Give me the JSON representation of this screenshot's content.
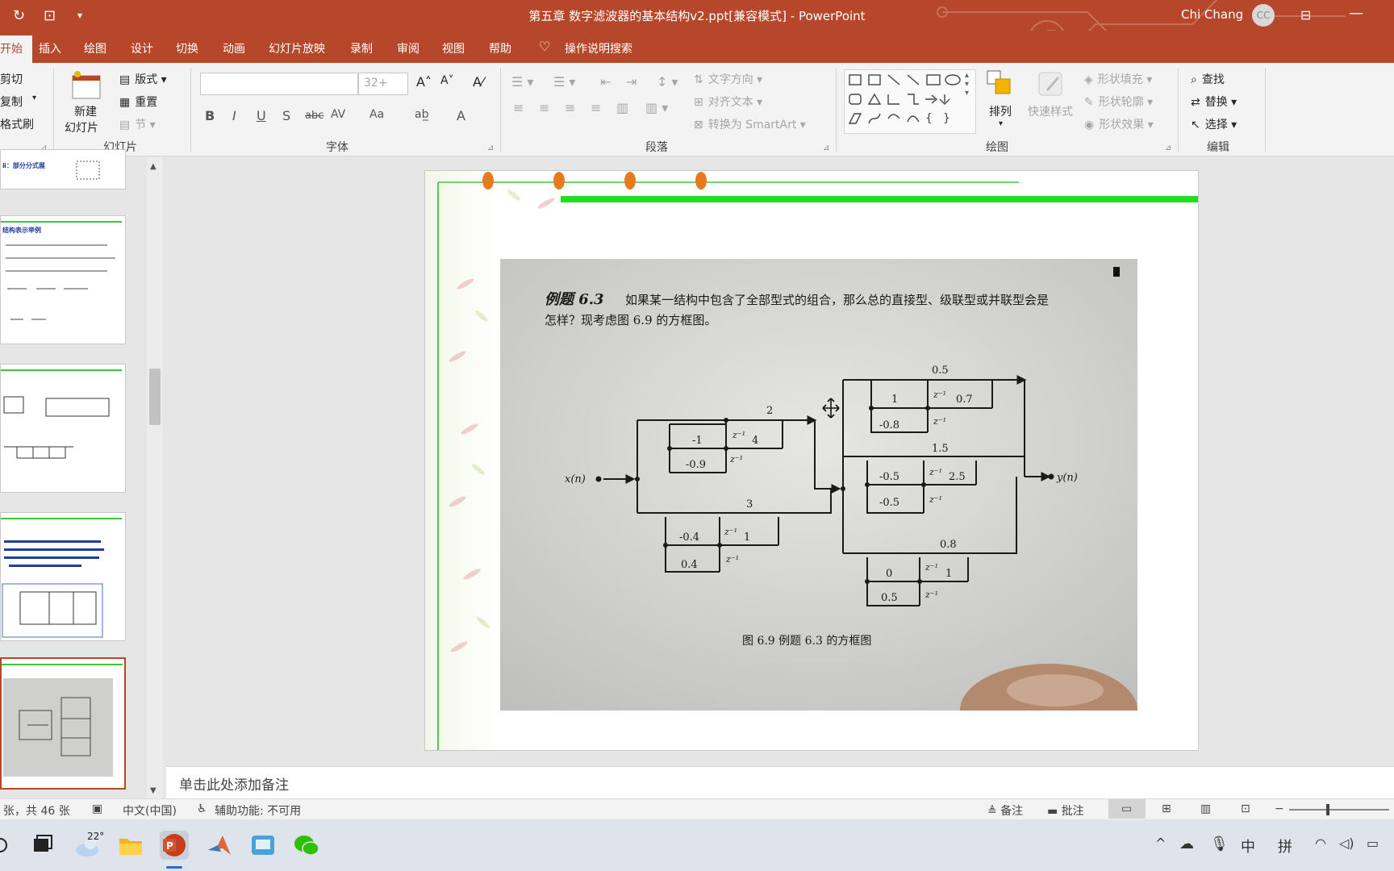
{
  "window": {
    "title": "第五章 数字滤波器的基本结构v2.ppt[兼容模式] - PowerPoint",
    "user": "Chi Chang",
    "avatar_initials": "CC"
  },
  "quick_access": {
    "refresh_icon": "refresh-icon",
    "present_icon": "present-from-start-icon",
    "more_icon": "customize-qat-icon"
  },
  "tabs": [
    "开始",
    "插入",
    "绘图",
    "设计",
    "切换",
    "动画",
    "幻灯片放映",
    "录制",
    "审阅",
    "视图",
    "帮助",
    "操作说明搜索"
  ],
  "ribbon": {
    "clipboard": {
      "cut": "剪切",
      "copy": "复制",
      "format_painter": "格式刷"
    },
    "slides": {
      "new_slide": "新建",
      "new_slide_2": "幻灯片",
      "layout": "版式",
      "reset": "重置",
      "section": "节",
      "label": "幻灯片"
    },
    "font": {
      "size": "32+",
      "label": "字体",
      "buttons": [
        "B",
        "I",
        "U",
        "S",
        "abc",
        "AV",
        "Aa",
        "A"
      ]
    },
    "paragraph": {
      "text_direction": "文字方向",
      "align_text": "对齐文本",
      "smartart": "转换为 SmartArt",
      "label": "段落"
    },
    "drawing": {
      "arrange": "排列",
      "quick_styles": "快速样式",
      "shape_fill": "形状填充",
      "shape_outline": "形状轮廓",
      "shape_effects": "形状效果",
      "label": "绘图"
    },
    "editing": {
      "find": "查找",
      "replace": "替换",
      "select": "选择",
      "label": "编辑"
    }
  },
  "slide_panel": {
    "thumb1_text": "ⅱ：部分分式展",
    "thumb2_text": "结构表示举例"
  },
  "slide": {
    "example_title": "例题 6.3",
    "example_text_1": "如果某一结构中包含了全部型式的组合，那么总的直接型、级联型或并联型会是",
    "example_text_2": "怎样？现考虑图 6.9 的方框图。",
    "input_label": "x(n)",
    "output_label": "y(n)",
    "delay": "z⁻¹",
    "coefficients": {
      "a_top": "2",
      "a_m1": "-1",
      "a_4": "4",
      "a_m09": "-0.9",
      "b_top": "3",
      "b_m04": "-0.4",
      "b_1": "1",
      "b_04": "0.4",
      "c_top": "0.5",
      "c_1": "1",
      "c_07": "0.7",
      "c_m08": "-0.8",
      "d_top": "1.5",
      "d_m05a": "-0.5",
      "d_25": "2.5",
      "d_m05b": "-0.5",
      "e_top": "0.8",
      "e_0": "0",
      "e_1": "1",
      "e_05": "0.5"
    },
    "caption": "图 6.9   例题 6.3 的方框图"
  },
  "notes_placeholder": "单击此处添加备注",
  "status": {
    "slide_count": "张，共 46 张",
    "language": "中文(中国)",
    "accessibility": "辅助功能: 不可用",
    "notes": "备注",
    "comments": "批注"
  },
  "taskbar": {
    "weather": "22°",
    "ime_lang": "中",
    "ime_mode": "拼"
  },
  "colors": {
    "accent": "#b7472a",
    "ribbon": "#f3f3f3",
    "slide_green": "#22dd22",
    "dots": "#e87a1e"
  }
}
